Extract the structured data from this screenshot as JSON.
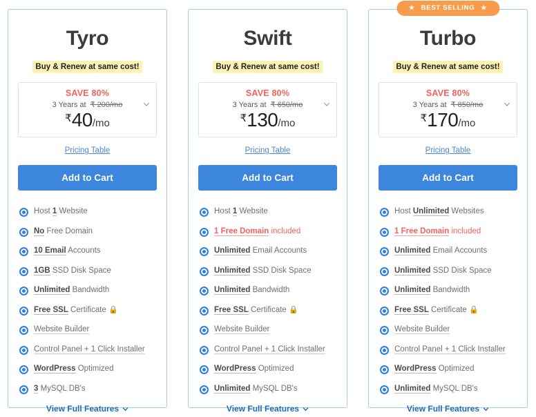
{
  "colors": {
    "card_border": "#a8cbe8",
    "badge_bg": "#f89b4b",
    "accent_blue": "#3c86dd",
    "accent_red": "#f4615e",
    "highlight_yellow": "#fdf3b5",
    "link_blue": "#4a86d8",
    "bullet_blue": "#2f7fe0",
    "lock_green": "#22b14c"
  },
  "common": {
    "tagline": "Buy & Renew at same cost!",
    "save_label": "SAVE 80%",
    "term_label": "3 Years at",
    "per_month": "/mo",
    "currency": "₹",
    "pricing_table_link": "Pricing Table",
    "add_to_cart_label": "Add to Cart",
    "view_full_features_label": "View Full Features",
    "badge_label": "BEST SELLING",
    "badge_star": "★",
    "lock_glyph": "🔒"
  },
  "plans": [
    {
      "name": "Tyro",
      "badge": null,
      "price": "40",
      "old_price": "₹ 200/mo",
      "features": [
        {
          "strong": "",
          "pre": "Host ",
          "mid": "1",
          "post": " Website",
          "style": "plain"
        },
        {
          "strong": "No",
          "post": " Free Domain",
          "style": "strong"
        },
        {
          "strong": "10 Email",
          "post": " Accounts",
          "style": "strong"
        },
        {
          "strong": "1GB",
          "post": " SSD Disk Space",
          "style": "strong"
        },
        {
          "strong": "Unlimited",
          "post": " Bandwidth",
          "style": "strong"
        },
        {
          "strong": "Free SSL",
          "post": " Certificate",
          "style": "strong",
          "lock": true
        },
        {
          "strong": "",
          "post": "Website Builder",
          "style": "underline"
        },
        {
          "strong": "",
          "post": "Control Panel + 1 Click Installer",
          "style": "underline"
        },
        {
          "strong": "WordPress",
          "post": " Optimized",
          "style": "strong"
        },
        {
          "strong": "",
          "pre": "",
          "mid": "3",
          "post": " MySQL DB's",
          "style": "plain"
        }
      ]
    },
    {
      "name": "Swift",
      "badge": null,
      "price": "130",
      "old_price": "₹ 650/mo",
      "features": [
        {
          "strong": "",
          "pre": "Host ",
          "mid": "1",
          "post": " Website",
          "style": "plain"
        },
        {
          "strong": "1 Free Domain",
          "post": " included",
          "style": "strong",
          "red": true
        },
        {
          "strong": "Unlimited",
          "post": " Email Accounts",
          "style": "strong"
        },
        {
          "strong": "Unlimited",
          "post": " SSD Disk Space",
          "style": "strong"
        },
        {
          "strong": "Unlimited",
          "post": " Bandwidth",
          "style": "strong"
        },
        {
          "strong": "Free SSL",
          "post": " Certificate",
          "style": "strong",
          "lock": true
        },
        {
          "strong": "",
          "post": "Website Builder",
          "style": "underline"
        },
        {
          "strong": "",
          "post": "Control Panel + 1 Click Installer",
          "style": "underline"
        },
        {
          "strong": "WordPress",
          "post": " Optimized",
          "style": "strong"
        },
        {
          "strong": "Unlimited",
          "post": " MySQL DB's",
          "style": "strong"
        }
      ]
    },
    {
      "name": "Turbo",
      "badge": "BEST SELLING",
      "price": "170",
      "old_price": "₹ 850/mo",
      "features": [
        {
          "strong": "Unlimited",
          "pre": "Host ",
          "post": " Websites",
          "style": "strong"
        },
        {
          "strong": "1 Free Domain",
          "post": " included",
          "style": "strong",
          "red": true
        },
        {
          "strong": "Unlimited",
          "post": " Email Accounts",
          "style": "strong"
        },
        {
          "strong": "Unlimited",
          "post": " SSD Disk Space",
          "style": "strong"
        },
        {
          "strong": "Unlimited",
          "post": " Bandwidth",
          "style": "strong"
        },
        {
          "strong": "Free SSL",
          "post": " Certificate",
          "style": "strong",
          "lock": true
        },
        {
          "strong": "",
          "post": "Website Builder",
          "style": "underline"
        },
        {
          "strong": "",
          "post": "Control Panel + 1 Click Installer",
          "style": "underline"
        },
        {
          "strong": "WordPress",
          "post": " Optimized",
          "style": "strong"
        },
        {
          "strong": "Unlimited",
          "post": " MySQL DB's",
          "style": "strong"
        }
      ]
    }
  ]
}
